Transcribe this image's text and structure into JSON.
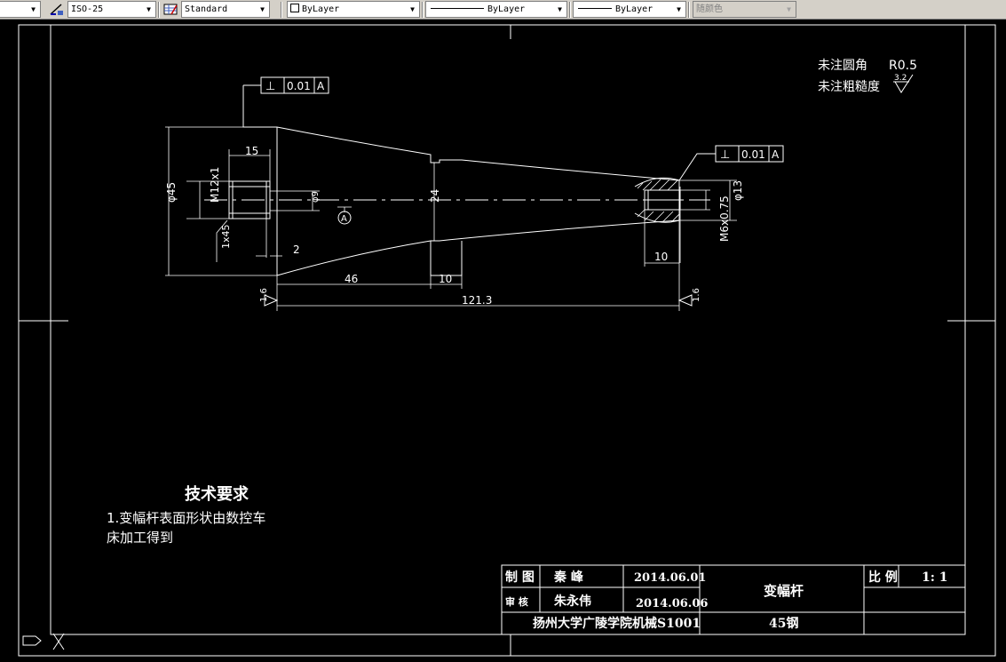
{
  "toolbar": {
    "dim_style": "ISO-25",
    "table_style": "Standard",
    "layer": "ByLayer",
    "linetype": "ByLayer",
    "lineweight": "ByLayer",
    "plot_color": "随颜色"
  },
  "notes": {
    "fillet_label": "未注圆角",
    "fillet_value": "R0.5",
    "roughness_label": "未注粗糙度",
    "roughness_value": "3.2"
  },
  "tolerance": {
    "symbol": "⊥",
    "value": "0.01",
    "datum": "A"
  },
  "dimensions": {
    "d45": "φ45",
    "d15": "15",
    "m12": "M12x1",
    "d9": "φ9",
    "chamfer": "1x45",
    "d2": "2",
    "d24": "24",
    "d46": "46",
    "d10a": "10",
    "d121": "121.3",
    "d13": "φ13",
    "d10b": "10",
    "m6": "M6x0.75",
    "rough_left": "1.6",
    "rough_right": "1.6",
    "datum_label": "A"
  },
  "tech": {
    "heading": "技术要求",
    "line1": "1.变幅杆表面形状由数控车",
    "line2": "床加工得到"
  },
  "title_block": {
    "drawn_label": "制 图",
    "drawn_name": "秦 峰",
    "drawn_date": "2014.06.01",
    "check_label": "审 核",
    "check_name": "朱永伟",
    "check_date": "2014.06.06",
    "part_name": "变幅杆",
    "scale_label": "比 例",
    "scale_value": "1: 1",
    "school": "扬州大学广陵学院机械S1001",
    "material": "45钢"
  }
}
